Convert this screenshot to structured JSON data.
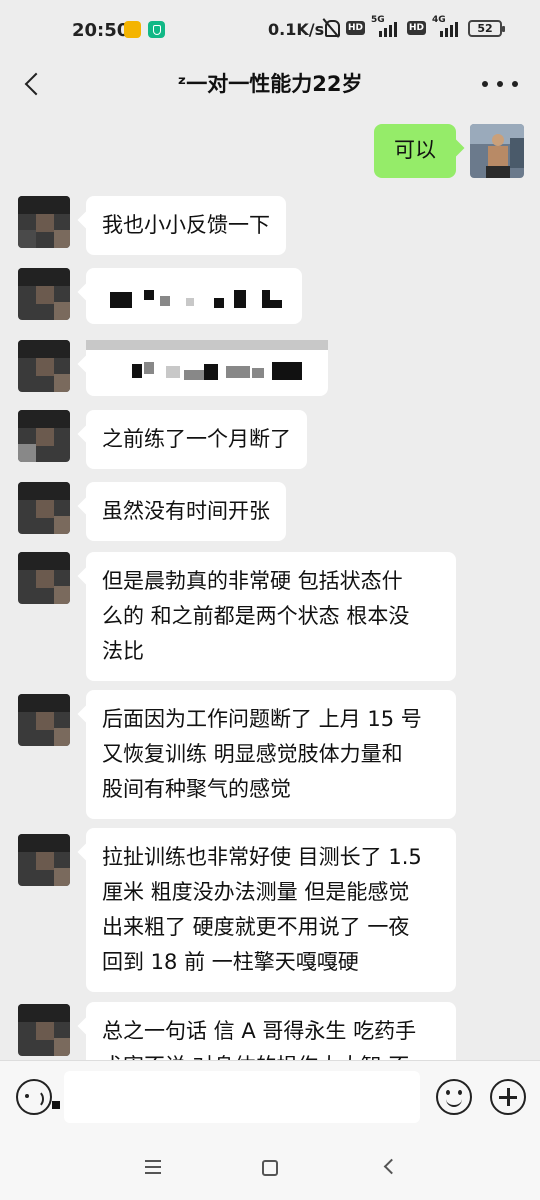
{
  "status_bar": {
    "time": "20:50",
    "network_speed": "0.1K/s",
    "hd_label": "HD",
    "signal1_label": "5G",
    "signal2_label": "4G",
    "battery": "52"
  },
  "header": {
    "title": "ᶻ一对一性能力22岁"
  },
  "messages": [
    {
      "sender": "self",
      "text": "可以"
    },
    {
      "sender": "other",
      "text": "我也小小反馈一下"
    },
    {
      "sender": "other",
      "text": "",
      "redacted": true
    },
    {
      "sender": "other",
      "text": "",
      "redacted": true
    },
    {
      "sender": "other",
      "text": "之前练了一个月断了"
    },
    {
      "sender": "other",
      "text": "虽然没有时间开张"
    },
    {
      "sender": "other",
      "lines": [
        "但是晨勃真的非常硬 包括状态什",
        "么的 和之前都是两个状态 根本没",
        "法比"
      ]
    },
    {
      "sender": "other",
      "lines": [
        "后面因为工作问题断了 上月 15 号",
        "又恢复训练 明显感觉肢体力量和",
        "股间有种聚气的感觉"
      ]
    },
    {
      "sender": "other",
      "lines": [
        "拉扯训练也非常好使 目测长了 1.5",
        "厘米 粗度没办法测量 但是能感觉",
        "出来粗了 硬度就更不用说了 一夜",
        "回到 18 前 一柱擎天嘎嘎硬"
      ]
    },
    {
      "sender": "other",
      "lines": [
        "总之一句话 信 A 哥得永生 吃药手",
        "术害不说 对身体的损伤太大智 不"
      ]
    }
  ],
  "input": {
    "placeholder": ""
  },
  "icons": {
    "back": "back-arrow-icon",
    "more": "more-dots-icon",
    "voice": "voice-icon",
    "emoji": "emoji-icon",
    "plus": "plus-icon"
  }
}
